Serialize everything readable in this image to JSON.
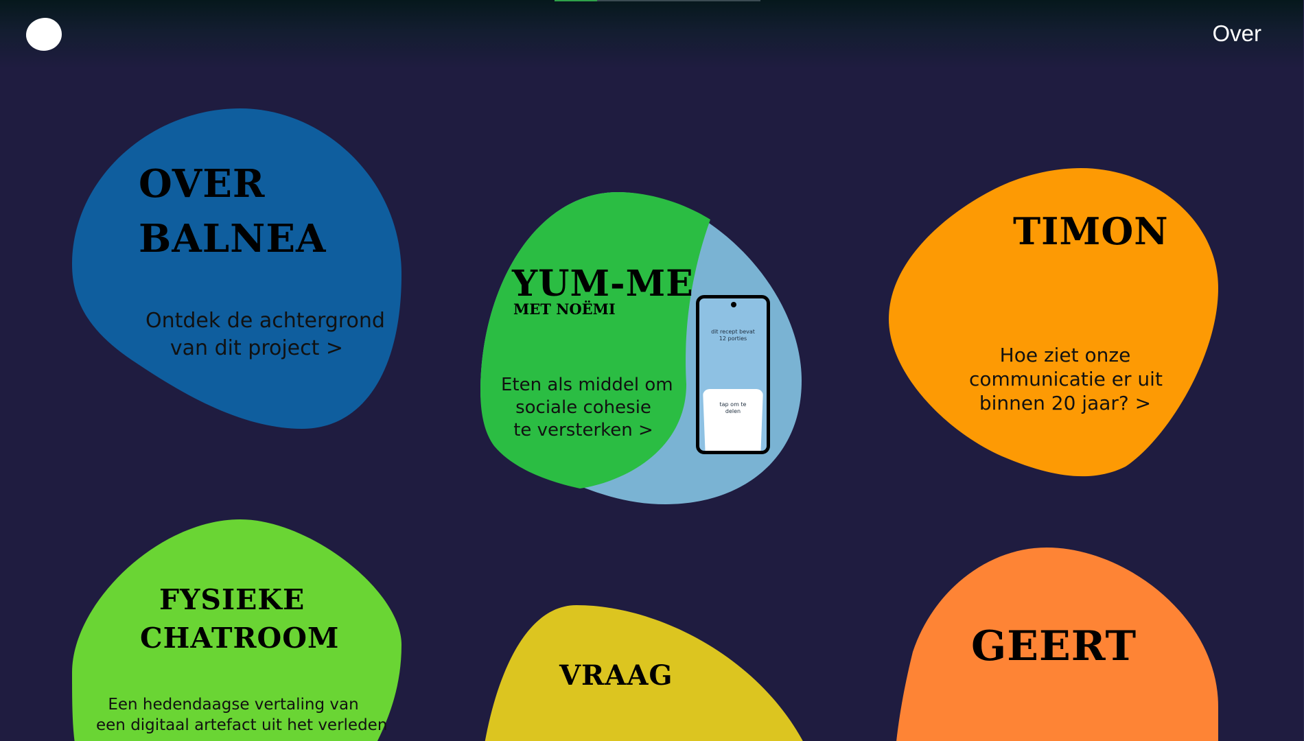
{
  "nav": {
    "over_label": "Over"
  },
  "colors": {
    "background": "#1f1c40",
    "over_balnea": "#0f5e9e",
    "yumme_green": "#2bbd43",
    "yumme_blue": "#7ab3d3",
    "timon": "#fd9a04",
    "fysieke_chatroom": "#6ad534",
    "vraag": "#dcc520",
    "geert": "#fe8435"
  },
  "cards": {
    "over_balnea": {
      "title_line1": "OVER",
      "title_line2": "BALNEA",
      "desc_line1": "Ontdek de achtergrond",
      "desc_line2": "van dit project >"
    },
    "yumme": {
      "title": "YUM-ME",
      "subtitle": "MET NOËMI",
      "desc_line1": "Eten als middel om",
      "desc_line2": "sociale cohesie",
      "desc_line3": "te versterken >",
      "phone_text_top_1": "dit recept bevat",
      "phone_text_top_2": "12 porties",
      "phone_text_cup_1": "tap om te",
      "phone_text_cup_2": "delen"
    },
    "timon": {
      "title": "TIMON",
      "desc_line1": "Hoe ziet onze",
      "desc_line2": "communicatie er uit",
      "desc_line3": "binnen 20 jaar? >"
    },
    "fysieke_chatroom": {
      "title_line1": "FYSIEKE",
      "title_line2": "CHATROOM",
      "desc_line1": "Een hedendaagse vertaling van",
      "desc_line2": "een digitaal artefact uit het verleden"
    },
    "vraag": {
      "title": "VRAAG"
    },
    "geert": {
      "title": "GEERT"
    }
  }
}
